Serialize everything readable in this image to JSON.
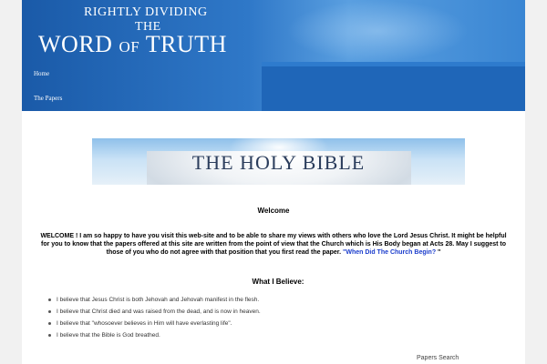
{
  "header": {
    "title_line1": "RIGHTLY DIVIDING",
    "title_line2": "THE",
    "title_word": "WORD",
    "title_of": "OF",
    "title_truth": "TRUTH"
  },
  "nav": {
    "home": "Home",
    "papers": "The Papers"
  },
  "banner": {
    "text": "THE HOLY BIBLE"
  },
  "content": {
    "welcome_heading": "Welcome",
    "intro_text": "WELCOME ! I am so happy to have you visit this web-site and to be able to share my views with others who love the Lord Jesus Christ. It might be helpful for you to know that the papers offered at this site are written from the point of view that the Church which is His Body began at Acts 28. May I suggest to those of you who do not agree with that position that you first read the paper. ",
    "intro_link": "\"When Did The Church Begin?",
    "intro_end": " \"",
    "believe_heading": "What I Believe:",
    "beliefs": [
      "I believe that Jesus Christ is both Jehovah and Jehovah manifest in the flesh.",
      "I believe that Christ died and was raised from the dead, and is now in heaven.",
      "I believe that \"whosoever believes in Him will have everlasting life\".",
      "I believe that the Bible is God breathed."
    ]
  },
  "sidebar": {
    "papers_search": "Papers Search"
  },
  "colors": {
    "header_blue": "#2f78c8",
    "nav_blue": "#1f66b8",
    "link_blue": "#1a3ccc"
  }
}
